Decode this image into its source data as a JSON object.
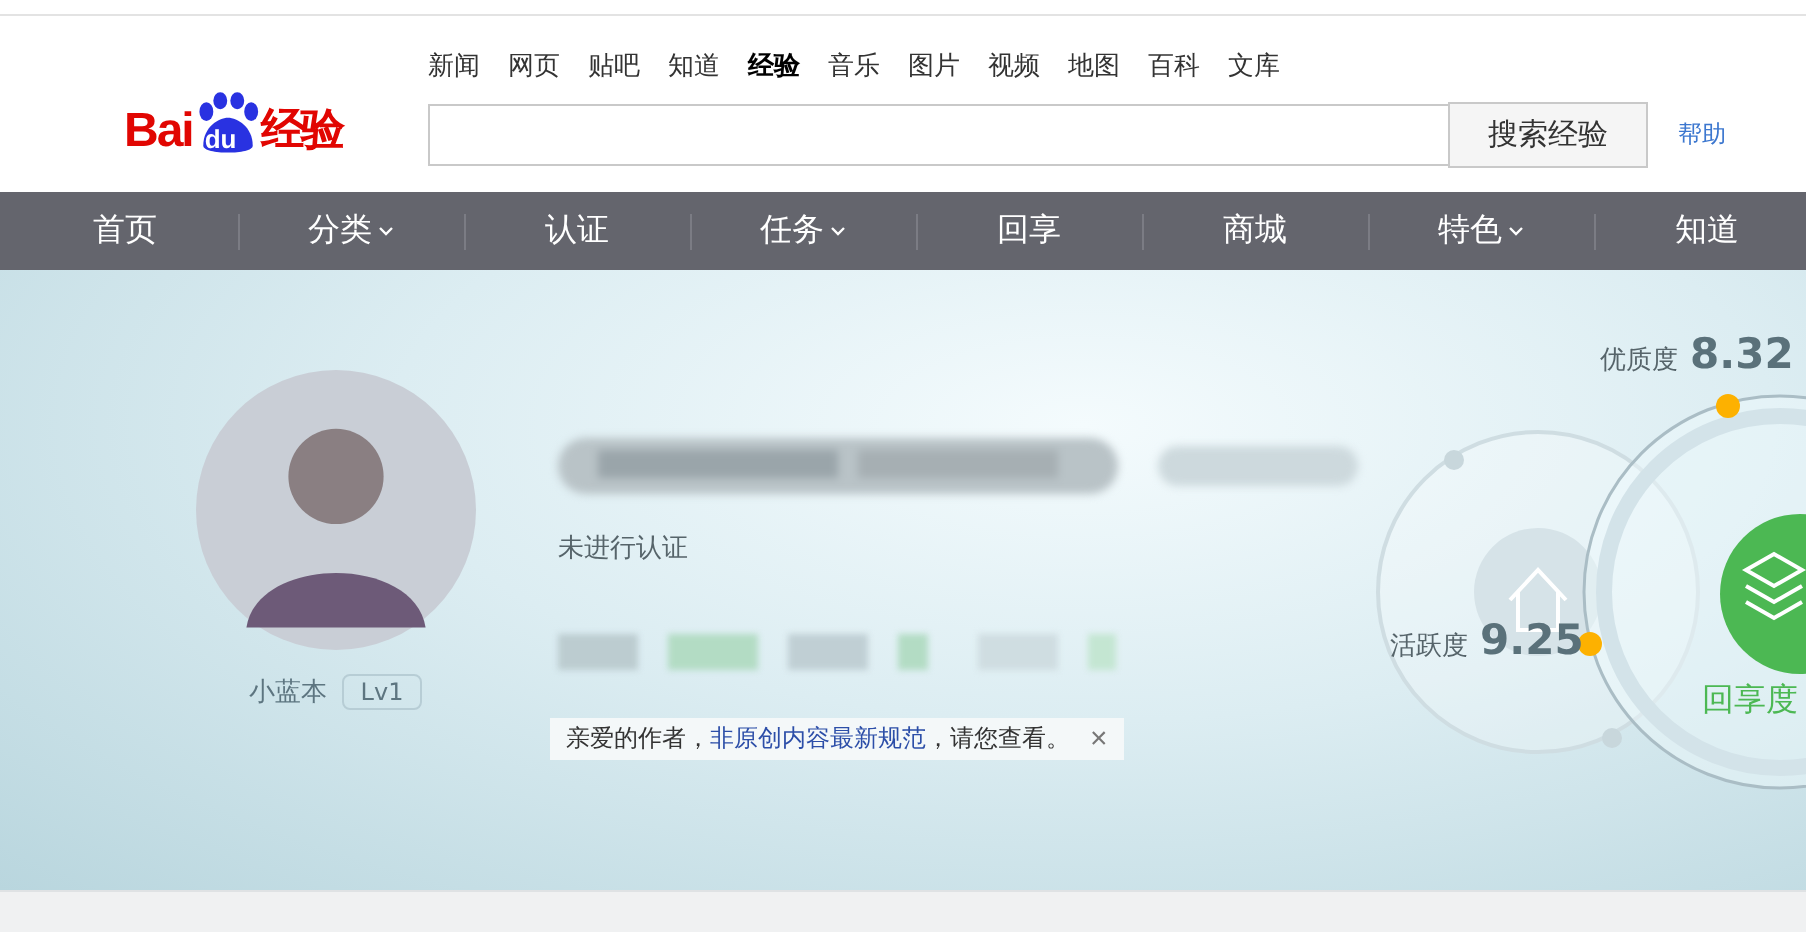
{
  "logo": {
    "text": "Bai",
    "mark": "du",
    "suffix": "经验"
  },
  "top_links": [
    {
      "label": "新闻",
      "selected": false
    },
    {
      "label": "网页",
      "selected": false
    },
    {
      "label": "贴吧",
      "selected": false
    },
    {
      "label": "知道",
      "selected": false
    },
    {
      "label": "经验",
      "selected": true
    },
    {
      "label": "音乐",
      "selected": false
    },
    {
      "label": "图片",
      "selected": false
    },
    {
      "label": "视频",
      "selected": false
    },
    {
      "label": "地图",
      "selected": false
    },
    {
      "label": "百科",
      "selected": false
    },
    {
      "label": "文库",
      "selected": false
    }
  ],
  "search": {
    "button": "搜索经验"
  },
  "help_link": "帮助",
  "nav": [
    {
      "label": "首页",
      "dropdown": false
    },
    {
      "label": "分类",
      "dropdown": true
    },
    {
      "label": "认证",
      "dropdown": false
    },
    {
      "label": "任务",
      "dropdown": true
    },
    {
      "label": "回享",
      "dropdown": false
    },
    {
      "label": "商城",
      "dropdown": false
    },
    {
      "label": "特色",
      "dropdown": true
    },
    {
      "label": "知道",
      "dropdown": false
    }
  ],
  "profile": {
    "username": "小蓝本",
    "level": "Lv1",
    "certification": "未进行认证"
  },
  "notice": {
    "before": "亲爱的作者，",
    "link": "非原创内容最新规范",
    "after": "，请您查看。",
    "close": "×"
  },
  "scores": [
    {
      "label": "优质度",
      "value": "8.32"
    },
    {
      "label": "活跃度",
      "value": "9.25"
    }
  ],
  "share_label": "回享度"
}
